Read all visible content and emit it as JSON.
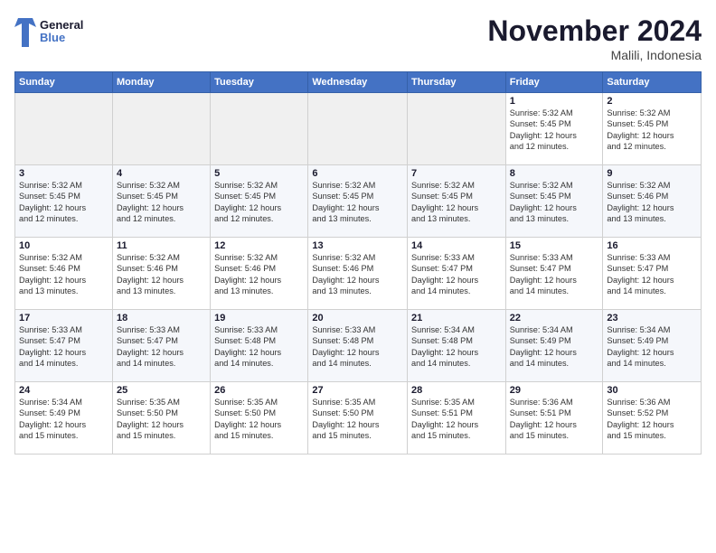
{
  "logo": {
    "line1": "General",
    "line2": "Blue"
  },
  "title": "November 2024",
  "location": "Malili, Indonesia",
  "days_header": [
    "Sunday",
    "Monday",
    "Tuesday",
    "Wednesday",
    "Thursday",
    "Friday",
    "Saturday"
  ],
  "weeks": [
    [
      {
        "day": "",
        "info": ""
      },
      {
        "day": "",
        "info": ""
      },
      {
        "day": "",
        "info": ""
      },
      {
        "day": "",
        "info": ""
      },
      {
        "day": "",
        "info": ""
      },
      {
        "day": "1",
        "info": "Sunrise: 5:32 AM\nSunset: 5:45 PM\nDaylight: 12 hours\nand 12 minutes."
      },
      {
        "day": "2",
        "info": "Sunrise: 5:32 AM\nSunset: 5:45 PM\nDaylight: 12 hours\nand 12 minutes."
      }
    ],
    [
      {
        "day": "3",
        "info": "Sunrise: 5:32 AM\nSunset: 5:45 PM\nDaylight: 12 hours\nand 12 minutes."
      },
      {
        "day": "4",
        "info": "Sunrise: 5:32 AM\nSunset: 5:45 PM\nDaylight: 12 hours\nand 12 minutes."
      },
      {
        "day": "5",
        "info": "Sunrise: 5:32 AM\nSunset: 5:45 PM\nDaylight: 12 hours\nand 12 minutes."
      },
      {
        "day": "6",
        "info": "Sunrise: 5:32 AM\nSunset: 5:45 PM\nDaylight: 12 hours\nand 13 minutes."
      },
      {
        "day": "7",
        "info": "Sunrise: 5:32 AM\nSunset: 5:45 PM\nDaylight: 12 hours\nand 13 minutes."
      },
      {
        "day": "8",
        "info": "Sunrise: 5:32 AM\nSunset: 5:45 PM\nDaylight: 12 hours\nand 13 minutes."
      },
      {
        "day": "9",
        "info": "Sunrise: 5:32 AM\nSunset: 5:46 PM\nDaylight: 12 hours\nand 13 minutes."
      }
    ],
    [
      {
        "day": "10",
        "info": "Sunrise: 5:32 AM\nSunset: 5:46 PM\nDaylight: 12 hours\nand 13 minutes."
      },
      {
        "day": "11",
        "info": "Sunrise: 5:32 AM\nSunset: 5:46 PM\nDaylight: 12 hours\nand 13 minutes."
      },
      {
        "day": "12",
        "info": "Sunrise: 5:32 AM\nSunset: 5:46 PM\nDaylight: 12 hours\nand 13 minutes."
      },
      {
        "day": "13",
        "info": "Sunrise: 5:32 AM\nSunset: 5:46 PM\nDaylight: 12 hours\nand 13 minutes."
      },
      {
        "day": "14",
        "info": "Sunrise: 5:33 AM\nSunset: 5:47 PM\nDaylight: 12 hours\nand 14 minutes."
      },
      {
        "day": "15",
        "info": "Sunrise: 5:33 AM\nSunset: 5:47 PM\nDaylight: 12 hours\nand 14 minutes."
      },
      {
        "day": "16",
        "info": "Sunrise: 5:33 AM\nSunset: 5:47 PM\nDaylight: 12 hours\nand 14 minutes."
      }
    ],
    [
      {
        "day": "17",
        "info": "Sunrise: 5:33 AM\nSunset: 5:47 PM\nDaylight: 12 hours\nand 14 minutes."
      },
      {
        "day": "18",
        "info": "Sunrise: 5:33 AM\nSunset: 5:47 PM\nDaylight: 12 hours\nand 14 minutes."
      },
      {
        "day": "19",
        "info": "Sunrise: 5:33 AM\nSunset: 5:48 PM\nDaylight: 12 hours\nand 14 minutes."
      },
      {
        "day": "20",
        "info": "Sunrise: 5:33 AM\nSunset: 5:48 PM\nDaylight: 12 hours\nand 14 minutes."
      },
      {
        "day": "21",
        "info": "Sunrise: 5:34 AM\nSunset: 5:48 PM\nDaylight: 12 hours\nand 14 minutes."
      },
      {
        "day": "22",
        "info": "Sunrise: 5:34 AM\nSunset: 5:49 PM\nDaylight: 12 hours\nand 14 minutes."
      },
      {
        "day": "23",
        "info": "Sunrise: 5:34 AM\nSunset: 5:49 PM\nDaylight: 12 hours\nand 14 minutes."
      }
    ],
    [
      {
        "day": "24",
        "info": "Sunrise: 5:34 AM\nSunset: 5:49 PM\nDaylight: 12 hours\nand 15 minutes."
      },
      {
        "day": "25",
        "info": "Sunrise: 5:35 AM\nSunset: 5:50 PM\nDaylight: 12 hours\nand 15 minutes."
      },
      {
        "day": "26",
        "info": "Sunrise: 5:35 AM\nSunset: 5:50 PM\nDaylight: 12 hours\nand 15 minutes."
      },
      {
        "day": "27",
        "info": "Sunrise: 5:35 AM\nSunset: 5:50 PM\nDaylight: 12 hours\nand 15 minutes."
      },
      {
        "day": "28",
        "info": "Sunrise: 5:35 AM\nSunset: 5:51 PM\nDaylight: 12 hours\nand 15 minutes."
      },
      {
        "day": "29",
        "info": "Sunrise: 5:36 AM\nSunset: 5:51 PM\nDaylight: 12 hours\nand 15 minutes."
      },
      {
        "day": "30",
        "info": "Sunrise: 5:36 AM\nSunset: 5:52 PM\nDaylight: 12 hours\nand 15 minutes."
      }
    ]
  ]
}
